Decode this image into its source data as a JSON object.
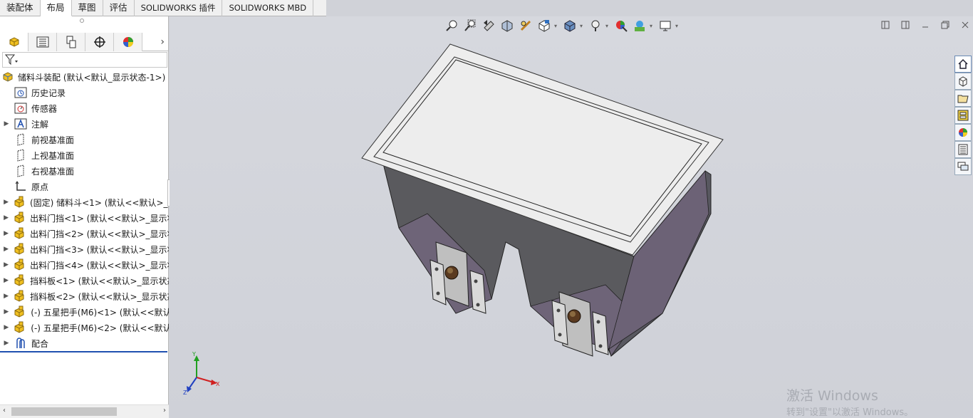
{
  "tabs": [
    {
      "label": "装配体",
      "active": false
    },
    {
      "label": "布局",
      "active": true
    },
    {
      "label": "草图",
      "active": false
    },
    {
      "label": "评估",
      "active": false
    },
    {
      "label": "SOLIDWORKS 插件",
      "active": false
    },
    {
      "label": "SOLIDWORKS MBD",
      "active": false
    }
  ],
  "tree": {
    "root": "储料斗装配  (默认<默认_显示状态-1>)",
    "items": [
      {
        "label": "历史记录",
        "icon": "history-icon",
        "expandable": false
      },
      {
        "label": "传感器",
        "icon": "sensor-icon",
        "expandable": false
      },
      {
        "label": "注解",
        "icon": "annotation-icon",
        "expandable": true
      },
      {
        "label": "前视基准面",
        "icon": "plane-icon",
        "expandable": false
      },
      {
        "label": "上视基准面",
        "icon": "plane-icon",
        "expandable": false
      },
      {
        "label": "右视基准面",
        "icon": "plane-icon",
        "expandable": false
      },
      {
        "label": "原点",
        "icon": "origin-icon",
        "expandable": false
      },
      {
        "label": "(固定) 储料斗<1> (默认<<默认>_显",
        "icon": "part-icon",
        "expandable": true
      },
      {
        "label": "出料门挡<1> (默认<<默认>_显示状",
        "icon": "part-icon",
        "expandable": true
      },
      {
        "label": "出料门挡<2> (默认<<默认>_显示状",
        "icon": "part-icon",
        "expandable": true
      },
      {
        "label": "出料门挡<3> (默认<<默认>_显示状",
        "icon": "part-icon",
        "expandable": true
      },
      {
        "label": "出料门挡<4> (默认<<默认>_显示状",
        "icon": "part-icon",
        "expandable": true
      },
      {
        "label": "挡料板<1> (默认<<默认>_显示状态",
        "icon": "part-icon",
        "expandable": true
      },
      {
        "label": "挡料板<2> (默认<<默认>_显示状态",
        "icon": "part-icon",
        "expandable": true
      },
      {
        "label": "(-) 五星把手(M6)<1> (默认<<默认",
        "icon": "part-icon",
        "expandable": true
      },
      {
        "label": "(-) 五星把手(M6)<2> (默认<<默认",
        "icon": "part-icon",
        "expandable": true
      },
      {
        "label": "配合",
        "icon": "mates-icon",
        "expandable": true
      }
    ]
  },
  "watermark": {
    "line1": "激活 Windows",
    "line2": "转到\"设置\"以激活 Windows。"
  },
  "triad": {
    "x": "X",
    "y": "Y",
    "z": "Z"
  },
  "colors": {
    "accent": "#2050b0",
    "part_yellow": "#f0c020",
    "hopper_face": "#5a5a5e",
    "hopper_inner": "#6e6478",
    "rim": "#ededed"
  }
}
